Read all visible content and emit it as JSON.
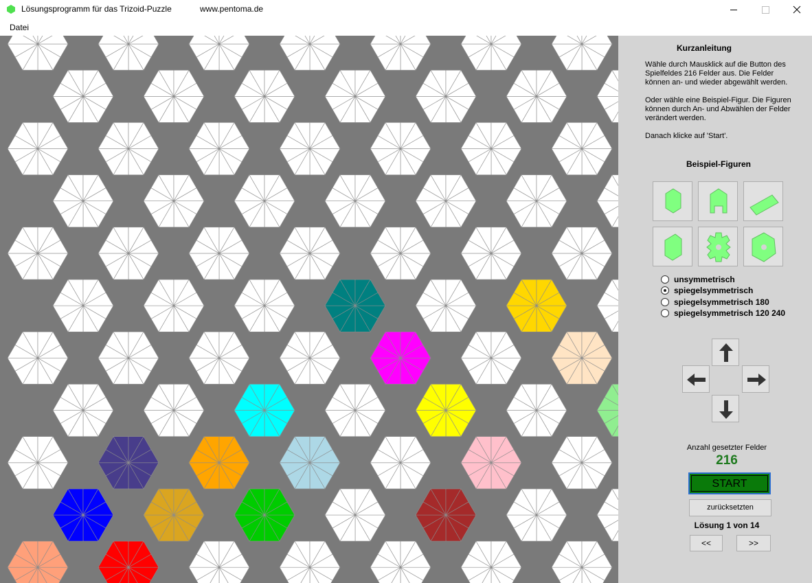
{
  "window": {
    "title": "Lösungsprogramm für das Trizoid-Puzzle",
    "url": "www.pentoma.de",
    "minimize_icon": "minimize-icon",
    "maximize_icon": "maximize-icon",
    "close_icon": "close-icon"
  },
  "menu": {
    "items": [
      "Datei"
    ]
  },
  "board": {
    "background_color": "#7a7a7a",
    "empty_field_color": "#ffffff",
    "grid_line_color": "#8c8c8c",
    "set_fields": 216
  },
  "panel": {
    "instructions_title": "Kurzanleitung",
    "instructions": [
      [
        "Wähle durch Mausklick auf die Button des",
        "Spielfeldes 216 Felder aus. Die Felder",
        "können an- und wieder abgewählt werden."
      ],
      [
        "Oder wähle eine Beispiel-Figur. Die Figuren",
        "können  durch An- und Abwählen der Felder",
        "verändert werden."
      ],
      [
        "Danach klicke auf 'Start'."
      ]
    ],
    "examples_title": "Beispiel-Figuren",
    "examples": [
      "hexagon-figure-icon",
      "house-figure-icon",
      "parallelogram-figure-icon",
      "hexagon-figure-icon",
      "gear-figure-icon",
      "ring-figure-icon"
    ],
    "example_color": "#80ff80",
    "symmetry_options": [
      "unsymmetrisch",
      "spiegelsymmetrisch",
      "spiegelsymmetrisch 180",
      "spiegelsymmetrisch 120 240"
    ],
    "symmetry_selected": "spiegelsymmetrisch",
    "arrows": [
      "arrow-up-icon",
      "arrow-left-icon",
      "arrow-right-icon",
      "arrow-down-icon"
    ],
    "count_label": "Anzahl gesetzter Felder",
    "count_value": "216",
    "start_label": "START",
    "reset_label": "zurücksetzten",
    "solution_text": "Lösung 1 von 14",
    "prev_label": "<<",
    "next_label": ">>",
    "start_color": "#0a7a0a",
    "count_color": "#1e7a1e"
  }
}
